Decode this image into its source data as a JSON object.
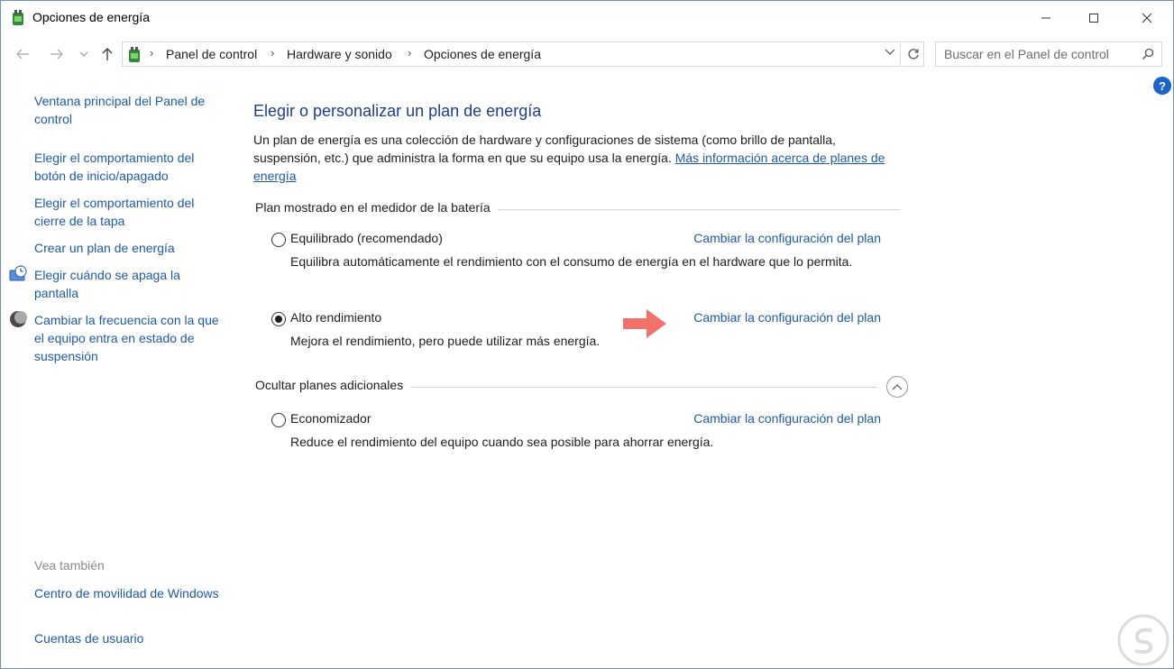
{
  "window": {
    "title": "Opciones de energía"
  },
  "nav": {
    "breadcrumbs": [
      "Panel de control",
      "Hardware y sonido",
      "Opciones de energía"
    ],
    "search_placeholder": "Buscar en el Panel de control"
  },
  "sidebar": {
    "items": [
      {
        "label": "Ventana principal del Panel de control"
      },
      {
        "label": "Elegir el comportamiento del botón de inicio/apagado"
      },
      {
        "label": "Elegir el comportamiento del cierre de la tapa"
      },
      {
        "label": "Crear un plan de energía"
      },
      {
        "label": "Elegir cuándo se apaga la pantalla",
        "icon": "display-clock-icon"
      },
      {
        "label": "Cambiar la frecuencia con la que el equipo entra en estado de suspensión",
        "icon": "moon-icon"
      }
    ],
    "see_also_title": "Vea también",
    "see_also": [
      {
        "label": "Centro de movilidad de Windows"
      },
      {
        "label": "Cuentas de usuario"
      }
    ]
  },
  "main": {
    "heading": "Elegir o personalizar un plan de energía",
    "description": "Un plan de energía es una colección de hardware y configuraciones de sistema (como brillo de pantalla, suspensión, etc.) que administra la forma en que su equipo usa la energía.",
    "more_info_link": "Más información acerca de planes de energía",
    "battery_section_title": "Plan mostrado en el medidor de la batería",
    "hide_section_title": "Ocultar planes adicionales",
    "plans": [
      {
        "name": "Equilibrado (recomendado)",
        "description": "Equilibra automáticamente el rendimiento con el consumo de energía en el hardware que lo permita.",
        "link": "Cambiar la configuración del plan",
        "selected": false
      },
      {
        "name": "Alto rendimiento",
        "description": "Mejora el rendimiento, pero puede utilizar más energía.",
        "link": "Cambiar la configuración del plan",
        "selected": true
      },
      {
        "name": "Economizador",
        "description": "Reduce el rendimiento del equipo cuando sea posible para ahorrar energía.",
        "link": "Cambiar la configuración del plan",
        "selected": false
      }
    ]
  },
  "colors": {
    "link": "#1e5aa8",
    "heading": "#1f3d8a",
    "arrow": "#f0726a"
  }
}
